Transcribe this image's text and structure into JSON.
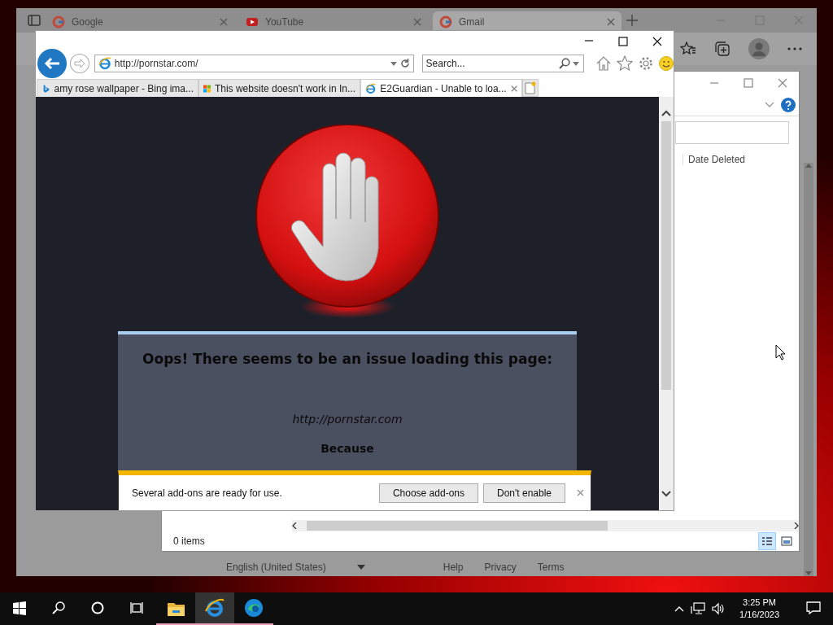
{
  "edge_window": {
    "tabs": [
      {
        "kind": "google",
        "label": "Google",
        "selected": false
      },
      {
        "kind": "youtube",
        "label": "YouTube",
        "selected": false
      },
      {
        "kind": "google",
        "label": "Gmail",
        "selected": true
      }
    ],
    "footer": {
      "language": "English (United States)",
      "links": [
        "Help",
        "Privacy",
        "Terms"
      ]
    }
  },
  "explorer_window": {
    "columns": [
      "Date Deleted"
    ],
    "status": "0 items",
    "views": [
      {
        "kind": "details",
        "selected": true
      },
      {
        "kind": "preview",
        "selected": false
      }
    ]
  },
  "ie_window": {
    "address": "http://pornstar.com/",
    "search": {
      "placeholder": "Search..."
    },
    "tabs": [
      {
        "kind": "bing",
        "label": "amy rose wallpaper - Bing ima...",
        "selected": false
      },
      {
        "kind": "windows",
        "label": "This website doesn't work in In...",
        "selected": false
      },
      {
        "kind": "ie",
        "label": "E2Guardian - Unable to loa...",
        "selected": true
      }
    ],
    "page": {
      "heading": "Oops! There seems to be an issue loading this page:",
      "url": "http://pornstar.com",
      "because": "Because"
    },
    "notification": {
      "message": "Several add-ons are ready for use.",
      "buttons": [
        "Choose add-ons",
        "Don't enable"
      ]
    }
  },
  "taskbar": {
    "apps": [
      {
        "kind": "explorer",
        "running": true,
        "selected": false
      },
      {
        "kind": "ie",
        "running": true,
        "selected": true
      },
      {
        "kind": "edge",
        "running": true,
        "selected": false
      }
    ],
    "time": "3:25 PM",
    "date": "1/16/2023"
  }
}
